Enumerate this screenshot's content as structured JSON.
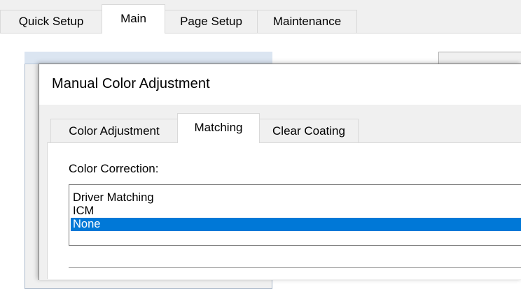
{
  "outer_tabs": [
    "Quick Setup",
    "Main",
    "Page Setup",
    "Maintenance"
  ],
  "outer_active_tab": "Main",
  "dialog": {
    "title": "Manual Color Adjustment",
    "tabs": [
      "Color Adjustment",
      "Matching",
      "Clear Coating"
    ],
    "active_tab": "Matching",
    "color_correction": {
      "label": "Color Correction:",
      "options": [
        "Driver Matching",
        "ICM",
        "None"
      ],
      "selected": "None"
    }
  },
  "colors": {
    "selection": "#0078d7",
    "window_bg": "#f0f0f0",
    "border": "#7a7a7a"
  }
}
